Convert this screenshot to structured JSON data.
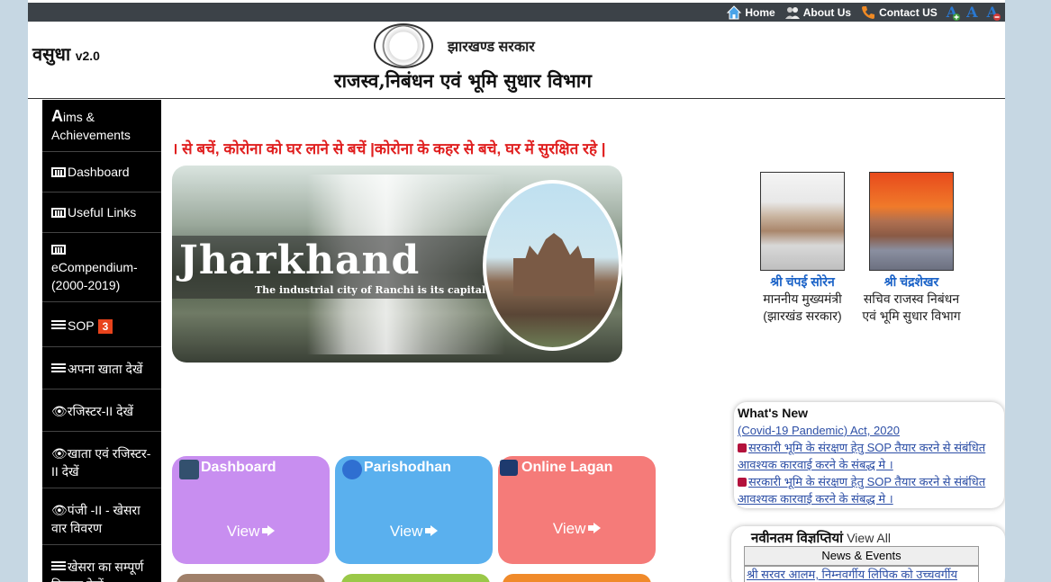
{
  "topnav": {
    "home": "Home",
    "about": "About Us",
    "contact": "Contact US",
    "font_plus": "A",
    "font_normal": "A",
    "font_minus": "A"
  },
  "header": {
    "brand": "वसुधा",
    "version": "v2.0",
    "gov": "झारखण्ड सरकार",
    "dept": "राजस्व,निबंधन एवं भूमि सुधार  विभाग"
  },
  "sidebar": {
    "items": [
      {
        "label": "ims & Achievements",
        "cap": "A"
      },
      {
        "label": "Dashboard",
        "icon": "chart-icon"
      },
      {
        "label": "Useful Links",
        "icon": "chart-icon"
      },
      {
        "label": "eCompendium-(2000-2019)",
        "icon": "chart-icon"
      },
      {
        "label": "SOP",
        "icon": "list-icon",
        "badge": "3"
      },
      {
        "label": "अपना खाता देखें",
        "icon": "list-icon"
      },
      {
        "label": "रजिस्टर-II देखें",
        "icon": "eye-icon"
      },
      {
        "label": "खाता एवं रजिस्टर-II देखें",
        "icon": "eye-icon"
      },
      {
        "label": "पंजी -II - खेसरा वार विवरण",
        "icon": "eye-icon"
      },
      {
        "label": "खेसरा का सम्पूर्ण विवरण देखें",
        "icon": "list-icon"
      }
    ]
  },
  "marquee": "। से बचें, कोरोना को घर लाने से बचें |कोरोना के कहर से बचे, घर में सुरक्षित रहे |",
  "banner": {
    "title": "Jharkhand",
    "caption": "The industrial city of Ranchi is its capital"
  },
  "people": [
    {
      "name": "श्री चंपई सोरेन",
      "desig": "माननीय मुख्यमंत्री (झारखंड सरकार)"
    },
    {
      "name": "श्री चंद्रशेखर",
      "desig": "सचिव राजस्व निबंधन एवं भूमि सुधार विभाग"
    }
  ],
  "tiles": [
    {
      "title": "Dashboard",
      "view": "View",
      "color": "#c88ef0"
    },
    {
      "title": "Parishodhan",
      "view": "View",
      "color": "#5ab0ee"
    },
    {
      "title": "Online Lagan",
      "view": "View",
      "color": "#f57b79"
    }
  ],
  "whatsnew": {
    "heading": "What's New",
    "items": [
      "(Covid-19 Pandemic) Act, 2020",
      "सरकारी भूमि के संरक्षण हेतु SOP तैयार करने से संबंधित आवश्यक कारवाई करने के संबद्ध मे ।",
      "सरकारी भूमि के संरक्षण हेतु SOP तैयार करने से संबंधित आवश्यक कारवाई करने के संबद्ध मे ।"
    ]
  },
  "notices": {
    "title": "नवीनतम विज्ञप्तियां",
    "view_all": "View All",
    "tab": "News & Events",
    "row": "श्री सरवर आलम, निम्नवर्गीय लिपिक को उच्चवर्गीय"
  }
}
